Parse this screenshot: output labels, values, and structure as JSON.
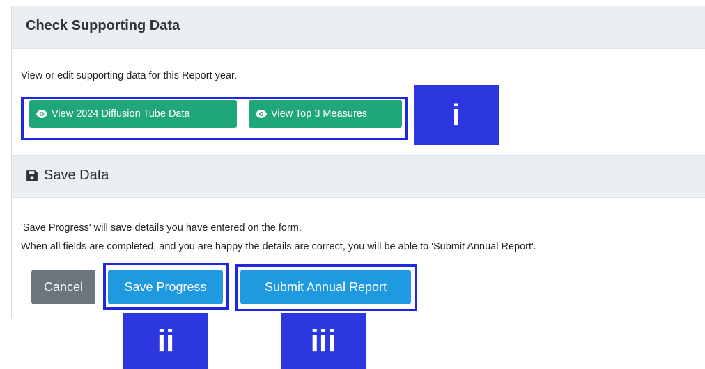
{
  "supporting": {
    "title": "Check Supporting Data",
    "description": "View or edit supporting data for this Report year.",
    "buttons": [
      {
        "label": "View 2024 Diffusion Tube Data",
        "icon": "eye-icon"
      },
      {
        "label": "View Top 3 Measures",
        "icon": "eye-icon"
      }
    ]
  },
  "save_section": {
    "title": "Save Data",
    "icon": "floppy-disk-icon",
    "line1": "'Save Progress' will save details you have entered on the form.",
    "line2": "When all fields are completed, and you are happy the details are correct, you will be able to 'Submit Annual Report'."
  },
  "actions": {
    "cancel_label": "Cancel",
    "save_label": "Save Progress",
    "submit_label": "Submit Annual Report"
  },
  "callouts": {
    "i": "i",
    "ii": "ii",
    "iii": "iii"
  },
  "colors": {
    "teal_button": "#1fa67a",
    "primary_button": "#1f9ae0",
    "secondary_button": "#6c757d",
    "callout": "#2d37e0",
    "header_bg": "#eceff2"
  }
}
